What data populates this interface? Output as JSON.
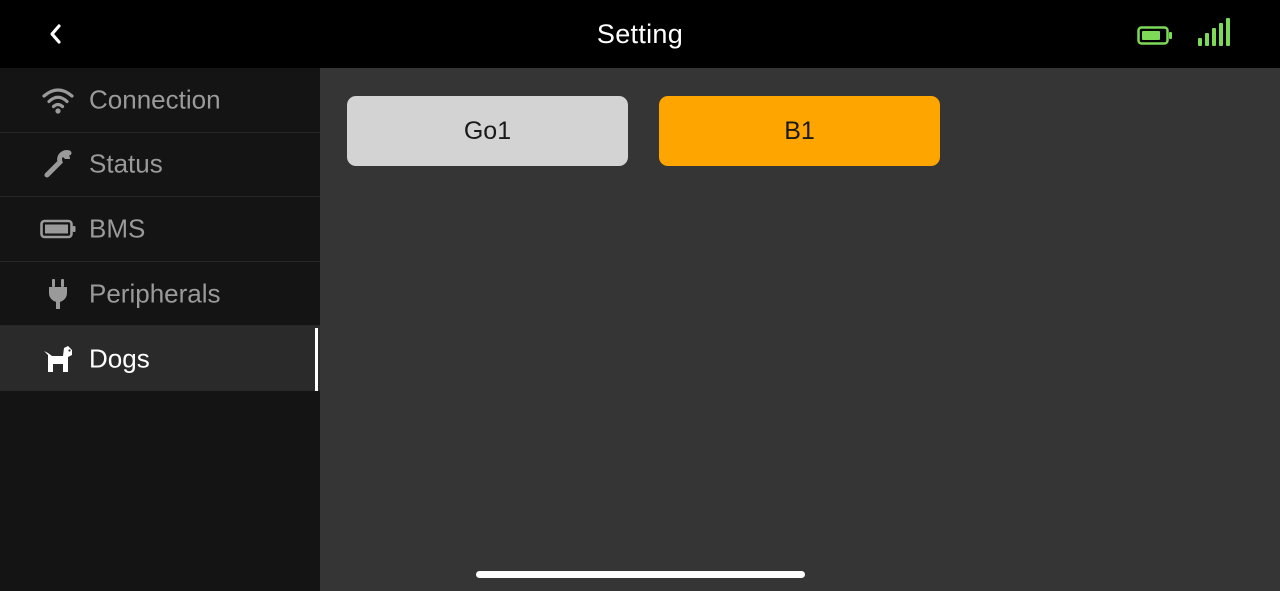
{
  "header": {
    "title": "Setting",
    "back_icon": "chevron-left-icon",
    "battery_icon": "battery-icon",
    "signal_icon": "signal-bars-icon",
    "status_color": "#7ed957"
  },
  "sidebar": {
    "active_index": 4,
    "items": [
      {
        "label": "Connection",
        "icon": "wifi-icon"
      },
      {
        "label": "Status",
        "icon": "wrench-icon"
      },
      {
        "label": "BMS",
        "icon": "battery-icon"
      },
      {
        "label": "Peripherals",
        "icon": "plug-icon"
      },
      {
        "label": "Dogs",
        "icon": "dog-icon"
      }
    ]
  },
  "main": {
    "models": [
      {
        "label": "Go1",
        "color": "#d3d3d3"
      },
      {
        "label": "B1",
        "color": "#ffa500",
        "selected": true
      }
    ]
  }
}
